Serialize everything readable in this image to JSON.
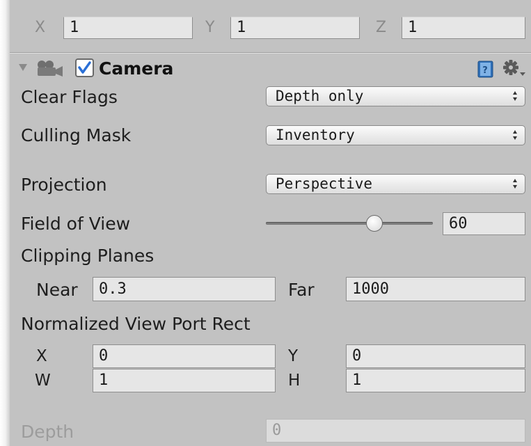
{
  "scale_row": {
    "x_label": "X",
    "x_value": "1",
    "y_label": "Y",
    "y_value": "1",
    "z_label": "Z",
    "z_value": "1"
  },
  "component": {
    "title": "Camera",
    "enabled": true,
    "icons": [
      "foldout-arrow-icon",
      "camera-icon",
      "checkbox-icon",
      "help-book-icon",
      "gear-menu-icon"
    ]
  },
  "clear_flags": {
    "label": "Clear Flags",
    "value": "Depth only"
  },
  "culling_mask": {
    "label": "Culling Mask",
    "value": "Inventory"
  },
  "projection": {
    "label": "Projection",
    "value": "Perspective"
  },
  "field_of_view": {
    "label": "Field of View",
    "value": "60",
    "slider_fraction": 0.5
  },
  "clipping_planes": {
    "label": "Clipping Planes",
    "near_label": "Near",
    "near_value": "0.3",
    "far_label": "Far",
    "far_value": "1000"
  },
  "viewport_rect": {
    "label": "Normalized View Port Rect",
    "x_label": "X",
    "x_value": "0",
    "y_label": "Y",
    "y_value": "0",
    "w_label": "W",
    "w_value": "1",
    "h_label": "H",
    "h_value": "1"
  },
  "depth": {
    "label": "Depth",
    "value": "0"
  },
  "colors": {
    "panel": "#c2c2c2",
    "field": "#e6e6e6",
    "check": "#2a6fd6"
  }
}
